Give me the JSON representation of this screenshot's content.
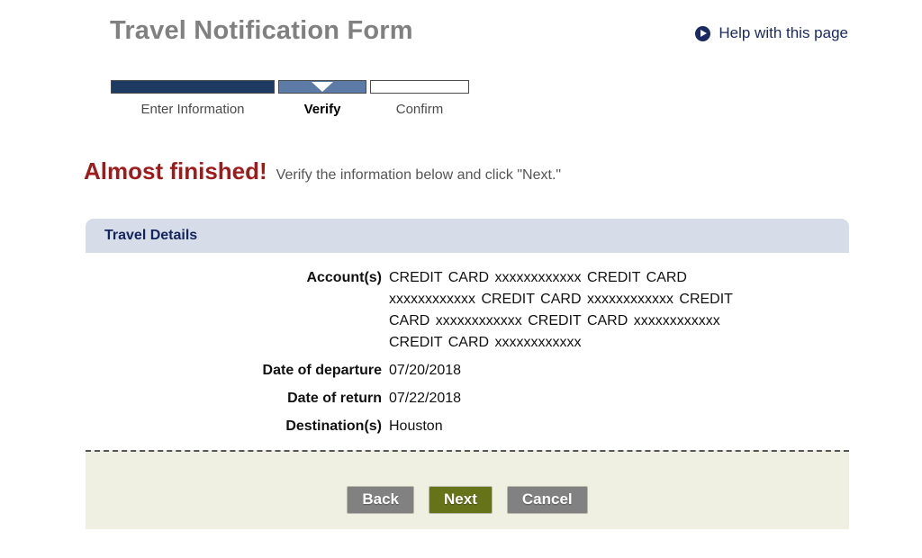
{
  "header": {
    "title": "Travel Notification Form",
    "help_link": {
      "label": "Help with this page",
      "icon": "play-circle-icon",
      "color": "#1b2a63"
    }
  },
  "stepper": {
    "steps": [
      {
        "label": "Enter Information",
        "state": "completed",
        "color": "#1d3a63"
      },
      {
        "label": "Verify",
        "state": "current",
        "color": "#5c7ba6"
      },
      {
        "label": "Confirm",
        "state": "upcoming",
        "color": "#ffffff"
      }
    ]
  },
  "banner": {
    "headline": "Almost finished!",
    "headline_color": "#9e1b1b",
    "subtext": "Verify the information below and click \"Next.\""
  },
  "panel": {
    "title": "Travel Details",
    "header_bg": "#d6dde8",
    "title_color": "#14245c",
    "fields": [
      {
        "label": "Account(s)",
        "value": "CREDIT CARD xxxxxxxxxxxx   CREDIT CARD xxxxxxxxxxxx   CREDIT CARD xxxxxxxxxxxx   CREDIT CARD xxxxxxxxxxxx   CREDIT CARD xxxxxxxxxxxx   CREDIT CARD xxxxxxxxxxxx"
      },
      {
        "label": "Date of departure",
        "value": "07/20/2018"
      },
      {
        "label": "Date of return",
        "value": "07/22/2018"
      },
      {
        "label": "Destination(s)",
        "value": "Houston"
      }
    ]
  },
  "footer": {
    "background": "#eff0e2",
    "buttons": [
      {
        "label": "Back",
        "style": "grey",
        "color": "#818181"
      },
      {
        "label": "Next",
        "style": "green",
        "color": "#667319"
      },
      {
        "label": "Cancel",
        "style": "grey",
        "color": "#818181"
      }
    ]
  }
}
